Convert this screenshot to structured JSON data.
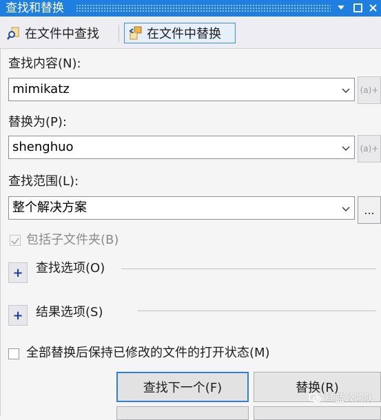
{
  "window": {
    "title": "查找和替换"
  },
  "tabs": [
    {
      "label": "在文件中查找",
      "icon": "find-in-files-icon",
      "selected": false
    },
    {
      "label": "在文件中替换",
      "icon": "replace-in-files-icon",
      "selected": true
    }
  ],
  "find": {
    "label": "查找内容(N):",
    "value": "mimikatz",
    "regex_button": "(a)+"
  },
  "replace": {
    "label": "替换为(P):",
    "value": "shenghuo",
    "regex_button": "(a)+"
  },
  "scope": {
    "label": "查找范围(L):",
    "value": "整个解决方案",
    "browse_button": "..."
  },
  "include_subfolders": {
    "label": "包括子文件夹(B)",
    "checked": true,
    "enabled": false
  },
  "find_options": {
    "label": "查找选项(O)",
    "expand_glyph": "+"
  },
  "result_options": {
    "label": "结果选项(S)",
    "expand_glyph": "+"
  },
  "keep_open": {
    "label": "全部替换后保持已修改的文件的打开状态(M)",
    "checked": false
  },
  "buttons": {
    "find_next": "查找下一个(F)",
    "replace": "替换(R)"
  },
  "watermark": {
    "text": "红蓝公鸿队"
  },
  "colors": {
    "titlebar": "#1e7fe0",
    "accent_border": "#3c8ee0",
    "expander_glyph": "#1c3f94"
  }
}
